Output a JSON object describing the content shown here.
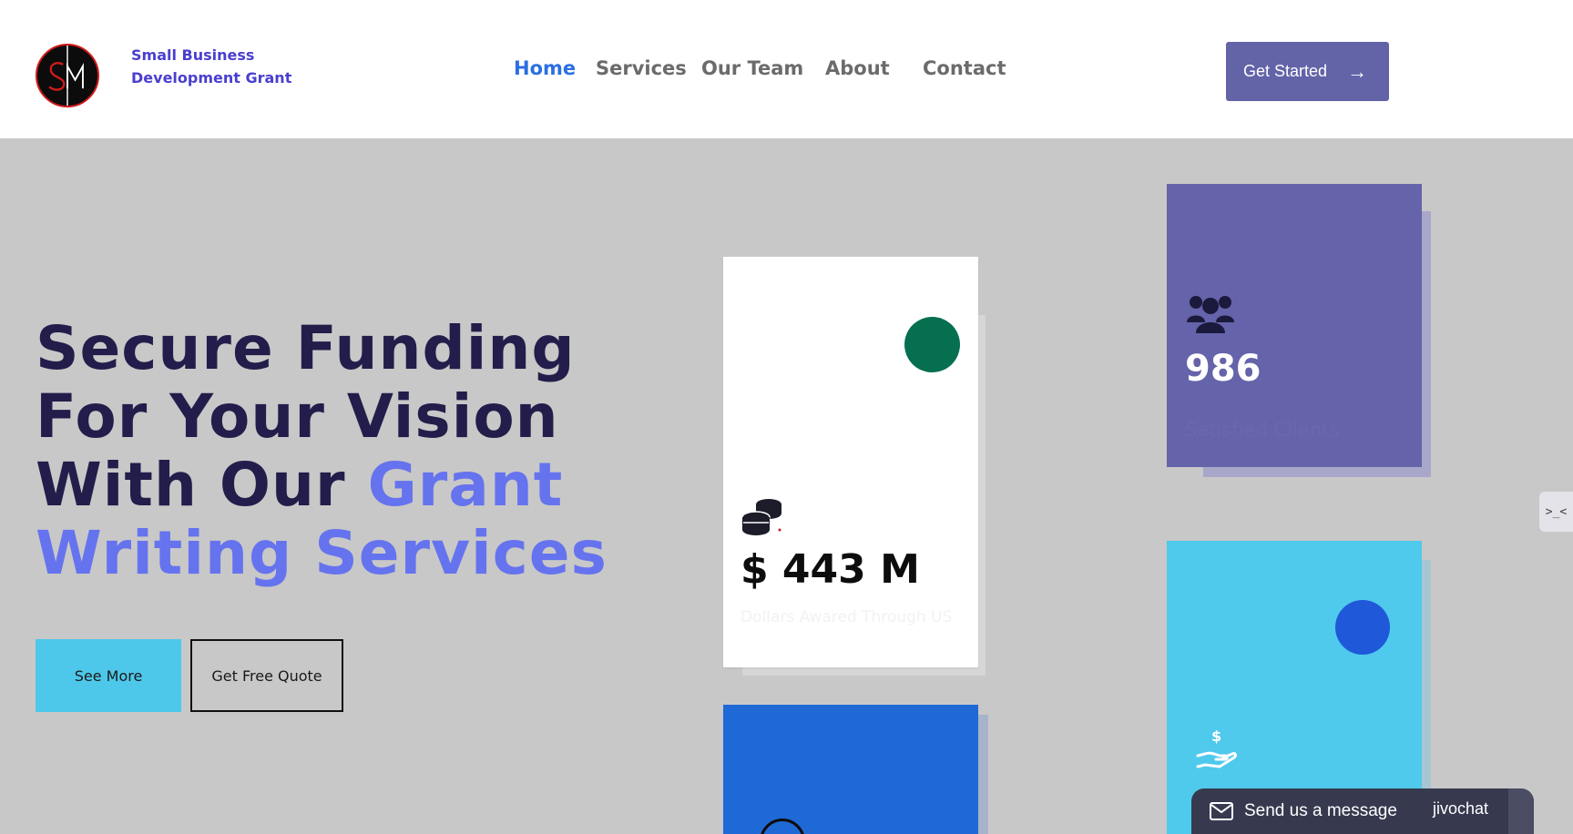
{
  "header": {
    "brand_line1": "Small Business",
    "brand_line2": "Development Grant",
    "nav": [
      {
        "label": "Home",
        "active": true
      },
      {
        "label": "Services",
        "active": false
      },
      {
        "label": "Our Team",
        "active": false
      },
      {
        "label": "About",
        "active": false
      },
      {
        "label": "Contact",
        "active": false
      }
    ],
    "cta_label": "Get Started",
    "cta_icon": "arrow-right-icon"
  },
  "hero": {
    "title_line1": "Secure Funding",
    "title_line2": "For Your Vision",
    "title_line3_prefix": "With Our ",
    "title_line3_accent": "Grant",
    "title_line4_accent": "Writing Services",
    "see_more_label": "See More",
    "quote_label": "Get Free Quote"
  },
  "stats": {
    "funding": {
      "icon": "coins-icon",
      "value": "$ 443 M",
      "caption": "Dollars Awared Through US"
    },
    "clients": {
      "icon": "users-icon",
      "value": "986",
      "caption": "Satisfied Clients"
    },
    "grants": {
      "icon": "hand-dollar-icon"
    }
  },
  "chat": {
    "label": "Send us a message",
    "brand": "jivochat"
  },
  "colors": {
    "accent_purple": "#6563aa",
    "accent_blue": "#2b6fe0",
    "hero_accent": "#6673ee",
    "dark_navy": "#221d4a",
    "cyan": "#4fc9ec",
    "green": "#066f4f"
  }
}
